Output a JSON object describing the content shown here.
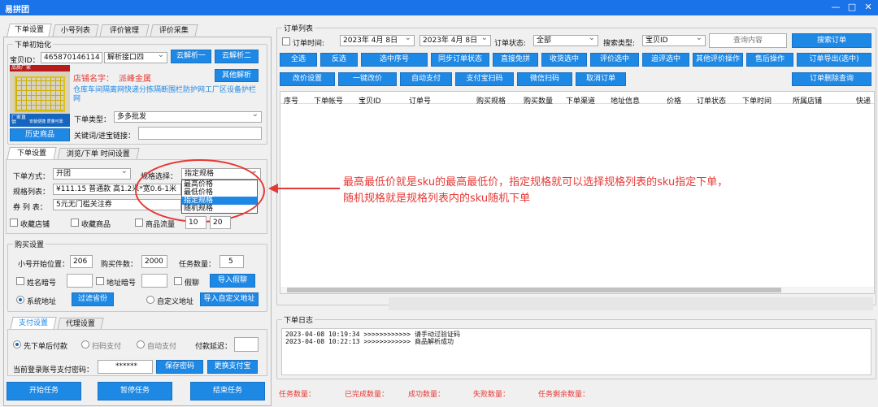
{
  "app": {
    "title": "易拼团"
  },
  "window": {
    "minimize": "—",
    "maximize": "□",
    "close": "✕"
  },
  "left_tabs": [
    "下单设置",
    "小号列表",
    "评价管理",
    "评价采集"
  ],
  "init": {
    "group": "下单初始化",
    "baby_id_label": "宝贝ID：",
    "baby_id": "465870146114",
    "parse_api": "解析接口四",
    "cloud1": "云解析一",
    "cloud2": "云解析二",
    "other_parse": "其他解析",
    "shop_label": "店铺名字：",
    "shop_name": "派峰金属",
    "product_title": "仓库车间隔离网快递分拣隔断围栏防护网工厂区设备护栏网",
    "order_type_label": "下单类型：",
    "order_type": "多多批发",
    "history_btn": "历史商品",
    "keyword_label": "关键词/进宝链接：",
    "thumb_top": "品质厂家",
    "thumb_tag1": "厂家直供",
    "thumb_tag2": "安装便捷 质量可靠"
  },
  "sub_tabs": [
    "下单设置",
    "浏览/下单 时间设置"
  ],
  "order": {
    "method_label": "下单方式：",
    "method": "开团",
    "spec_select_label": "规格选择：",
    "spec_select": "指定规格",
    "spec_options": [
      "最高价格",
      "最低价格",
      "指定规格",
      "随机规格"
    ],
    "spec_list_label": "规格列表：",
    "spec_list_value": "¥111.15  普通款 高1.2米*宽0.6-1米",
    "coupon_label": "券 列 表：",
    "coupon_value": "5元无门槛关注券",
    "fav_shop": "收藏店铺",
    "fav_goods": "收藏商品",
    "goods_flow": "商品流量",
    "flow_min": "10",
    "flow_max": "20"
  },
  "purchase": {
    "group": "购买设置",
    "start_label": "小号开始位置：",
    "start": "206",
    "count_label": "购买件数：",
    "count": "2000",
    "task_label": "任务数量：",
    "task": "5",
    "name_dark": "姓名暗号",
    "addr_dark": "地址暗号",
    "fake_chat": "假聊",
    "import_fake": "导入假聊",
    "sys_addr": "系统地址",
    "filter_prov": "过滤省份",
    "custom_addr": "自定义地址",
    "import_custom": "导入自定义地址"
  },
  "pay_tabs": [
    "支付设置",
    "代理设置"
  ],
  "pay": {
    "pay_after": "先下单后付款",
    "scan_pay": "扫码支付",
    "auto_pay": "自动支付",
    "delay_label": "付款延迟：",
    "pwd_label": "当前登录账号支付密码：",
    "pwd": "******",
    "save_pwd": "保存密码",
    "change_pay": "更换支付宝"
  },
  "actions": {
    "start": "开始任务",
    "pause": "暂停任务",
    "end": "结束任务"
  },
  "orders": {
    "group": "订单列表",
    "time_label": "订单时间:",
    "date_from": "2023年 4月 8日",
    "date_to": "2023年 4月 8日",
    "status_label": "订单状态:",
    "status": "全部",
    "search_type_label": "搜索类型:",
    "search_type": "宝贝ID",
    "search_placeholder": "查询内容",
    "search_btn": "搜索订单",
    "row1": [
      "全选",
      "反选",
      "选中序号",
      "同步订单状态",
      "直接免拼",
      "收货选中",
      "评价选中",
      "追评选中",
      "其他评价操作",
      "售后操作",
      "订单导出(选中)"
    ],
    "row2": [
      "改价设置",
      "一键改价",
      "自动支付",
      "支付宝扫码",
      "微信扫码",
      "取消订单"
    ],
    "delete_query": "订单删除查询",
    "columns": [
      "序号",
      "下单帐号",
      "宝贝ID",
      "订单号",
      "购买规格",
      "购买数量",
      "下单渠道",
      "地址信息",
      "价格",
      "订单状态",
      "下单时间",
      "所属店铺",
      "快递"
    ]
  },
  "annotation": {
    "line1": "最高最低价就是sku的最高最低价，指定规格就可以选择规格列表的sku指定下单，",
    "line2": "随机规格就是规格列表内的sku随机下单"
  },
  "log": {
    "group": "下单日志",
    "entries": [
      "2023-04-08 10:19:34 >>>>>>>>>>>> 请手动过验证码",
      "2023-04-08 10:22:13 >>>>>>>>>>>> 商品解析成功"
    ]
  },
  "stats": [
    "任务数量：",
    "已完成数量：",
    "成功数量：",
    "失败数量：",
    "任务剩余数量："
  ],
  "colors": {
    "accent": "#1e88e5",
    "title": "#1a73e8",
    "annotation": "#e53935"
  }
}
